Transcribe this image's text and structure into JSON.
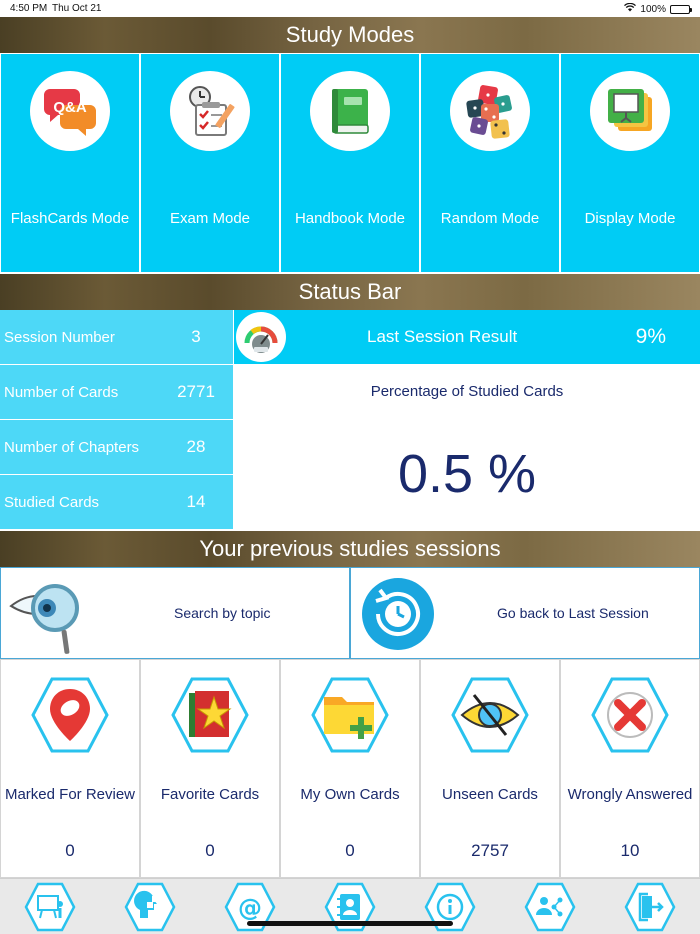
{
  "status_bar": {
    "time": "4:50 PM",
    "date": "Thu Oct 21",
    "battery": "100%"
  },
  "study_modes": {
    "title": "Study Modes",
    "modes": [
      {
        "label": "FlashCards Mode",
        "icon": "qa-bubbles-icon"
      },
      {
        "label": "Exam Mode",
        "icon": "exam-checklist-icon"
      },
      {
        "label": "Handbook Mode",
        "icon": "green-book-icon"
      },
      {
        "label": "Random Mode",
        "icon": "dice-icon"
      },
      {
        "label": "Display Mode",
        "icon": "presentation-icon"
      }
    ]
  },
  "status": {
    "title": "Status Bar",
    "rows": [
      {
        "label": "Session Number",
        "value": "3"
      },
      {
        "label": "Number of Cards",
        "value": "2771"
      },
      {
        "label": "Number of Chapters",
        "value": "28"
      },
      {
        "label": "Studied Cards",
        "value": "14"
      }
    ],
    "last_session": {
      "label": "Last Session Result",
      "value": "9%"
    },
    "studied_percentage": {
      "label": "Percentage of Studied Cards",
      "value": "0.5 %"
    }
  },
  "previous": {
    "title": "Your previous studies sessions",
    "search": {
      "label": "Search by topic",
      "icon": "magnifier-eye-icon"
    },
    "last": {
      "label": "Go back to Last Session",
      "icon": "clock-restore-icon"
    }
  },
  "categories": [
    {
      "label": "Marked For Review",
      "value": "0",
      "icon": "map-pin-icon"
    },
    {
      "label": "Favorite Cards",
      "value": "0",
      "icon": "star-folder-icon"
    },
    {
      "label": "My Own Cards",
      "value": "0",
      "icon": "folder-add-icon"
    },
    {
      "label": "Unseen Cards",
      "value": "2757",
      "icon": "eye-crossed-icon"
    },
    {
      "label": "Wrongly Answered",
      "value": "10",
      "icon": "red-x-icon"
    }
  ],
  "tabbar": {
    "tabs": [
      {
        "icon": "presenter-icon"
      },
      {
        "icon": "brain-puzzle-icon"
      },
      {
        "icon": "at-sign-icon"
      },
      {
        "icon": "address-book-icon"
      },
      {
        "icon": "info-icon"
      },
      {
        "icon": "share-users-icon"
      },
      {
        "icon": "exit-icon"
      }
    ]
  },
  "colors": {
    "tile_blue": "#00ccf5",
    "light_blue": "#4dd8f7",
    "navy_text": "#1a2a6c",
    "banner_brown": "#6b5a36"
  }
}
